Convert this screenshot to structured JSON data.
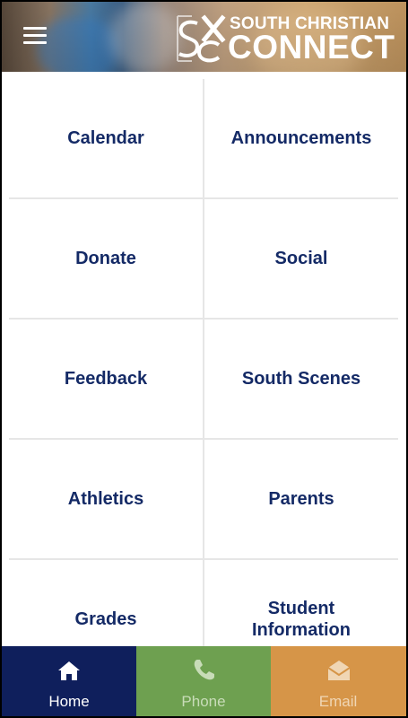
{
  "header": {
    "menu_icon": "hamburger-menu-icon",
    "logo": {
      "mark": "SC",
      "line1": "SOUTH CHRISTIAN",
      "line2": "CONNECT"
    }
  },
  "tiles": [
    {
      "label": "Calendar"
    },
    {
      "label": "Announcements"
    },
    {
      "label": "Donate"
    },
    {
      "label": "Social"
    },
    {
      "label": "Feedback"
    },
    {
      "label": "South Scenes"
    },
    {
      "label": "Athletics"
    },
    {
      "label": "Parents"
    },
    {
      "label": "Grades"
    },
    {
      "label": "Student\nInformation"
    }
  ],
  "bottom_nav": [
    {
      "label": "Home",
      "icon": "home-icon",
      "bg": "#0f1f5c",
      "fg": "#ffffff",
      "active": true
    },
    {
      "label": "Phone",
      "icon": "phone-icon",
      "bg": "#6ea050",
      "fg": "#c8dcb8",
      "active": false
    },
    {
      "label": "Email",
      "icon": "envelope-icon",
      "bg": "#d69548",
      "fg": "#f0d6b4",
      "active": false
    }
  ],
  "colors": {
    "tile_text": "#142a66",
    "divider": "#e6e6e6"
  }
}
